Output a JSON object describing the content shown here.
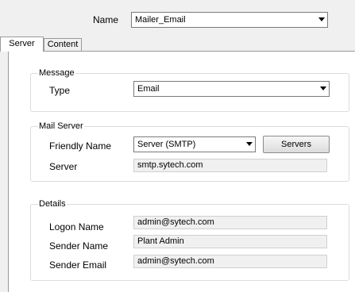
{
  "header": {
    "name_label": "Name",
    "name_value": "Mailer_Email"
  },
  "tabs": [
    {
      "label": "Server",
      "active": true
    },
    {
      "label": "Content",
      "active": false
    }
  ],
  "message": {
    "group_title": "Message",
    "type_label": "Type",
    "type_value": "Email"
  },
  "mail_server": {
    "group_title": "Mail Server",
    "friendly_name_label": "Friendly Name",
    "friendly_name_value": "Server (SMTP)",
    "servers_button": "Servers",
    "server_label": "Server",
    "server_value": "smtp.sytech.com"
  },
  "details": {
    "group_title": "Details",
    "logon_name_label": "Logon Name",
    "logon_name_value": "admin@sytech.com",
    "sender_name_label": "Sender Name",
    "sender_name_value": "Plant Admin",
    "sender_email_label": "Sender Email",
    "sender_email_value": "admin@sytech.com"
  },
  "colors": {
    "panel_bg": "#ffffff",
    "window_bg": "#f0f0f0",
    "group_border": "#dcdcdc"
  },
  "icons": {
    "dropdown": "chevron-down-icon"
  }
}
